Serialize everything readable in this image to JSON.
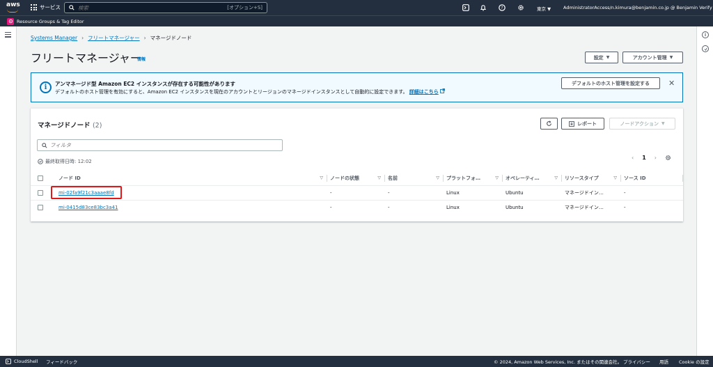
{
  "topbar": {
    "logo_text": "aws",
    "services_label": "サービス",
    "search_placeholder": "検索",
    "search_shortcut": "[オプション+S]",
    "region": "東京 ▼",
    "account": "AdministratorAccess/n.kimura@benjamin.co.jp @ Benjamin Verify ▼"
  },
  "subbar": {
    "label": "Resource Groups & Tag Editor"
  },
  "breadcrumb": {
    "root": "Systems Manager",
    "mid": "フリートマネージャー",
    "current": "マネージドノード"
  },
  "page": {
    "title": "フリートマネージャー",
    "info": "情報",
    "settings_btn": "設定",
    "account_btn": "アカウント管理"
  },
  "alert": {
    "heading": "アンマネージド型 Amazon EC2 インスタンスが存在する可能性があります",
    "body": "デフォルトのホスト管理を有効にすると、Amazon EC2 インスタンスを現在のアカウントとリージョンのマネージドインスタンスとして自動的に設定できます。",
    "link": "詳細はこちら",
    "button": "デフォルトのホスト管理を設定する"
  },
  "panel": {
    "title": "マネージドノード",
    "count": "(2)",
    "report_btn": "レポート",
    "node_action_btn": "ノードアクション",
    "filter_placeholder": "フィルタ",
    "last_fetch": "最終取得日時: 12:02",
    "page_number": "1"
  },
  "table": {
    "headers": [
      "ノード ID",
      "ノードの状態",
      "名前",
      "プラットフォ…",
      "オペレーティ…",
      "リソースタイプ",
      "ソース ID"
    ],
    "rows": [
      {
        "id": "mi-02fa9f21c3aaae8fd",
        "state": "-",
        "name": "-",
        "platform": "Linux",
        "os": "Ubuntu",
        "resource": "マネージドイン…",
        "source": "-"
      },
      {
        "id": "mi-0415d83ce83bc3a41",
        "state": "-",
        "name": "-",
        "platform": "Linux",
        "os": "Ubuntu",
        "resource": "マネージドイン…",
        "source": "-"
      }
    ]
  },
  "footer": {
    "cloudshell": "CloudShell",
    "feedback": "フィードバック",
    "copyright": "© 2024, Amazon Web Services, Inc. またはその関連会社。",
    "privacy": "プライバシー",
    "terms": "用語",
    "cookie": "Cookie の設定"
  },
  "colors": {
    "nav_bg": "#232f3e",
    "link": "#0073bb",
    "accent": "#ff9900",
    "highlight": "#e0181a"
  }
}
